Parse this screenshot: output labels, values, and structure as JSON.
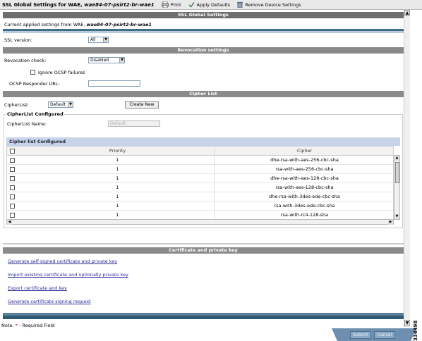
{
  "toolbar": {
    "title_prefix": "SSL Global Settings for WAE,",
    "device_name": "wae84-07-psirt2-br-wae1",
    "print": "Print",
    "apply_defaults": "Apply Defaults",
    "remove_device_settings": "Remove Device Settings"
  },
  "header": {
    "title": "SSL Global Settings",
    "current_prefix": "Current applied settings from WAE,",
    "current_device": "wae84-07-psirt2-br-wae1"
  },
  "ssl": {
    "version_label": "SSL version:",
    "version_value": "All"
  },
  "revocation": {
    "title": "Revocation settings",
    "check_label": "Revocation check:",
    "check_value": "Disabled",
    "ignore_label": "Ignore OCSP failures",
    "ocsp_url_label": "OCSP Responder URL:",
    "ocsp_url_value": ""
  },
  "cipher": {
    "title": "Cipher List",
    "list_label": "CipherList:",
    "list_value": "Default",
    "create_new": "Create New",
    "configured_legend": "CipherList Configured",
    "name_label": "CipherList Name:",
    "name_placeholder": "Default",
    "table_title": "Cipher list Configured",
    "columns": [
      "Priority",
      "Cipher"
    ],
    "rows": [
      {
        "priority": "1",
        "cipher": "dhe-rsa-with-aes-256-cbc-sha"
      },
      {
        "priority": "1",
        "cipher": "rsa-with-aes-256-cbc-sha"
      },
      {
        "priority": "1",
        "cipher": "dhe-rsa-with-aes-128-cbc-sha"
      },
      {
        "priority": "1",
        "cipher": "rsa-with-aes-128-cbc-sha"
      },
      {
        "priority": "1",
        "cipher": "dhe-rsa-with-3des-ede-cbc-sha"
      },
      {
        "priority": "1",
        "cipher": "rsa-with-3des-ede-cbc-sha"
      },
      {
        "priority": "1",
        "cipher": "rsa-with-rc4-128-sha"
      }
    ]
  },
  "certificate": {
    "title": "Certificate and private key",
    "links": [
      "Generate self-signed certificate and private key",
      "Import existing certificate and optionally private key",
      "Export certificate and key",
      "Generate certificate signing request"
    ]
  },
  "footer": {
    "note_prefix": "Note:",
    "asterisk": "*",
    "note_text": "- Required Field",
    "submit": "Submit",
    "cancel": "Cancel",
    "doc_id": "334498"
  },
  "colors": {
    "section_header": "#8a8a8a",
    "table_header": "#c7d3e8",
    "link": "#2b2b9c",
    "footer_bar": "#6e8fb0",
    "required": "#d40000"
  }
}
